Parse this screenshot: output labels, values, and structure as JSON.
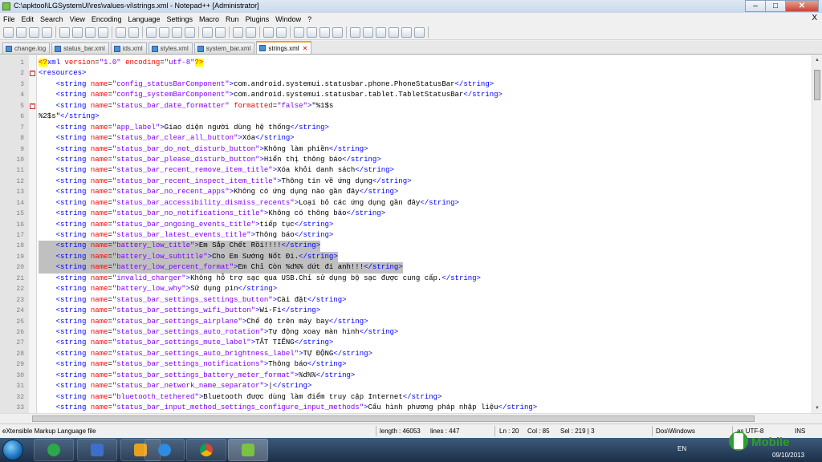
{
  "window": {
    "title": "C:\\apktool\\LGSystemUI\\res\\values-vi\\strings.xml - Notepad++ [Administrator]",
    "min_glyph": "–",
    "max_glyph": "□",
    "close_glyph": "✕"
  },
  "menu": [
    "File",
    "Edit",
    "Search",
    "View",
    "Encoding",
    "Language",
    "Settings",
    "Macro",
    "Run",
    "Plugins",
    "Window",
    "?"
  ],
  "menu_close": "X",
  "tabs": [
    {
      "label": "change.log"
    },
    {
      "label": "status_bar.xml"
    },
    {
      "label": "ids.xml"
    },
    {
      "label": "styles.xml"
    },
    {
      "label": "system_bar.xml"
    },
    {
      "label": "strings.xml",
      "active": true
    }
  ],
  "toolbar_icons": [
    "new-file",
    "open-file",
    "save",
    "save-all",
    "close",
    "close-all",
    "print",
    "cut",
    "copy",
    "paste",
    "undo",
    "redo",
    "find",
    "replace",
    "zoom-in",
    "zoom-out",
    "sync-v",
    "sync-h",
    "word-wrap",
    "all-chars",
    "indent-guide",
    "folder-view",
    "doc-map",
    "record-macro",
    "stop-record",
    "play-macro",
    "run-multiple",
    "save-macro",
    "spell-check",
    "compare"
  ],
  "lines": [
    {
      "n": "1",
      "fold": "",
      "segs": [
        [
          "pi",
          "<?"
        ],
        [
          "t",
          "xml "
        ],
        [
          "a",
          "version"
        ],
        [
          "x",
          "="
        ],
        [
          "v",
          "\"1.0\""
        ],
        [
          "x",
          " "
        ],
        [
          "a",
          "encoding"
        ],
        [
          "x",
          "="
        ],
        [
          "v",
          "\"utf-8\""
        ],
        [
          "pi",
          "?>"
        ]
      ]
    },
    {
      "n": "2",
      "fold": "-",
      "segs": [
        [
          "t",
          "<resources>"
        ]
      ]
    },
    {
      "n": "3",
      "fold": "",
      "segs": [
        [
          "x",
          "    "
        ],
        [
          "t",
          "<string "
        ],
        [
          "a",
          "name"
        ],
        [
          "x",
          "="
        ],
        [
          "v",
          "\"config_statusBarComponent\""
        ],
        [
          "t",
          ">"
        ],
        [
          "x",
          "com.android.systemui.statusbar.phone.PhoneStatusBar"
        ],
        [
          "t",
          "</string>"
        ]
      ]
    },
    {
      "n": "4",
      "fold": "",
      "segs": [
        [
          "x",
          "    "
        ],
        [
          "t",
          "<string "
        ],
        [
          "a",
          "name"
        ],
        [
          "x",
          "="
        ],
        [
          "v",
          "\"config_systemBarComponent\""
        ],
        [
          "t",
          ">"
        ],
        [
          "x",
          "com.android.systemui.statusbar.tablet.TabletStatusBar"
        ],
        [
          "t",
          "</string>"
        ]
      ]
    },
    {
      "n": "5",
      "fold": "-",
      "segs": [
        [
          "x",
          "    "
        ],
        [
          "t",
          "<string "
        ],
        [
          "a",
          "name"
        ],
        [
          "x",
          "="
        ],
        [
          "v",
          "\"status_bar_date_formatter\""
        ],
        [
          "x",
          " "
        ],
        [
          "a",
          "formatted"
        ],
        [
          "x",
          "="
        ],
        [
          "v",
          "\"false\""
        ],
        [
          "t",
          ">"
        ],
        [
          "x",
          "\"%1$s"
        ]
      ]
    },
    {
      "n": "6",
      "fold": "",
      "segs": [
        [
          "x",
          "%2$s\""
        ],
        [
          "t",
          "</string>"
        ]
      ]
    },
    {
      "n": "7",
      "fold": "",
      "segs": [
        [
          "x",
          "    "
        ],
        [
          "t",
          "<string "
        ],
        [
          "a",
          "name"
        ],
        [
          "x",
          "="
        ],
        [
          "v",
          "\"app_label\""
        ],
        [
          "t",
          ">"
        ],
        [
          "x",
          "Giao diện người dùng hệ thống"
        ],
        [
          "t",
          "</string>"
        ]
      ]
    },
    {
      "n": "8",
      "fold": "",
      "segs": [
        [
          "x",
          "    "
        ],
        [
          "t",
          "<string "
        ],
        [
          "a",
          "name"
        ],
        [
          "x",
          "="
        ],
        [
          "v",
          "\"status_bar_clear_all_button\""
        ],
        [
          "t",
          ">"
        ],
        [
          "x",
          "Xóa"
        ],
        [
          "t",
          "</string>"
        ]
      ]
    },
    {
      "n": "9",
      "fold": "",
      "segs": [
        [
          "x",
          "    "
        ],
        [
          "t",
          "<string "
        ],
        [
          "a",
          "name"
        ],
        [
          "x",
          "="
        ],
        [
          "v",
          "\"status_bar_do_not_disturb_button\""
        ],
        [
          "t",
          ">"
        ],
        [
          "x",
          "Không làm phiền"
        ],
        [
          "t",
          "</string>"
        ]
      ]
    },
    {
      "n": "10",
      "fold": "",
      "segs": [
        [
          "x",
          "    "
        ],
        [
          "t",
          "<string "
        ],
        [
          "a",
          "name"
        ],
        [
          "x",
          "="
        ],
        [
          "v",
          "\"status_bar_please_disturb_button\""
        ],
        [
          "t",
          ">"
        ],
        [
          "x",
          "Hiển thị thông báo"
        ],
        [
          "t",
          "</string>"
        ]
      ]
    },
    {
      "n": "11",
      "fold": "",
      "segs": [
        [
          "x",
          "    "
        ],
        [
          "t",
          "<string "
        ],
        [
          "a",
          "name"
        ],
        [
          "x",
          "="
        ],
        [
          "v",
          "\"status_bar_recent_remove_item_title\""
        ],
        [
          "t",
          ">"
        ],
        [
          "x",
          "Xóa khỏi danh sách"
        ],
        [
          "t",
          "</string>"
        ]
      ]
    },
    {
      "n": "12",
      "fold": "",
      "segs": [
        [
          "x",
          "    "
        ],
        [
          "t",
          "<string "
        ],
        [
          "a",
          "name"
        ],
        [
          "x",
          "="
        ],
        [
          "v",
          "\"status_bar_recent_inspect_item_title\""
        ],
        [
          "t",
          ">"
        ],
        [
          "x",
          "Thông tin về ứng dụng"
        ],
        [
          "t",
          "</string>"
        ]
      ]
    },
    {
      "n": "13",
      "fold": "",
      "segs": [
        [
          "x",
          "    "
        ],
        [
          "t",
          "<string "
        ],
        [
          "a",
          "name"
        ],
        [
          "x",
          "="
        ],
        [
          "v",
          "\"status_bar_no_recent_apps\""
        ],
        [
          "t",
          ">"
        ],
        [
          "x",
          "Không có ứng dụng nào gần đây"
        ],
        [
          "t",
          "</string>"
        ]
      ]
    },
    {
      "n": "14",
      "fold": "",
      "segs": [
        [
          "x",
          "    "
        ],
        [
          "t",
          "<string "
        ],
        [
          "a",
          "name"
        ],
        [
          "x",
          "="
        ],
        [
          "v",
          "\"status_bar_accessibility_dismiss_recents\""
        ],
        [
          "t",
          ">"
        ],
        [
          "x",
          "Loại bỏ các ứng dụng gần đây"
        ],
        [
          "t",
          "</string>"
        ]
      ]
    },
    {
      "n": "15",
      "fold": "",
      "segs": [
        [
          "x",
          "    "
        ],
        [
          "t",
          "<string "
        ],
        [
          "a",
          "name"
        ],
        [
          "x",
          "="
        ],
        [
          "v",
          "\"status_bar_no_notifications_title\""
        ],
        [
          "t",
          ">"
        ],
        [
          "x",
          "Không có thông báo"
        ],
        [
          "t",
          "</string>"
        ]
      ]
    },
    {
      "n": "16",
      "fold": "",
      "segs": [
        [
          "x",
          "    "
        ],
        [
          "t",
          "<string "
        ],
        [
          "a",
          "name"
        ],
        [
          "x",
          "="
        ],
        [
          "v",
          "\"status_bar_ongoing_events_title\""
        ],
        [
          "t",
          ">"
        ],
        [
          "x",
          "tiếp tục"
        ],
        [
          "t",
          "</string>"
        ]
      ]
    },
    {
      "n": "17",
      "fold": "",
      "segs": [
        [
          "x",
          "    "
        ],
        [
          "t",
          "<string "
        ],
        [
          "a",
          "name"
        ],
        [
          "x",
          "="
        ],
        [
          "v",
          "\"status_bar_latest_events_title\""
        ],
        [
          "t",
          ">"
        ],
        [
          "x",
          "Thông báo"
        ],
        [
          "t",
          "</string>"
        ]
      ]
    },
    {
      "n": "18",
      "fold": "",
      "hl": "sel",
      "segs": [
        [
          "x",
          "    "
        ],
        [
          "t",
          "<string "
        ],
        [
          "a",
          "name"
        ],
        [
          "x",
          "="
        ],
        [
          "v",
          "\"battery_low_title\""
        ],
        [
          "t",
          ">"
        ],
        [
          "x",
          "Em Sắp Chết Rồi!!!!"
        ],
        [
          "t",
          "</string>"
        ]
      ]
    },
    {
      "n": "19",
      "fold": "",
      "hl": "sel",
      "segs": [
        [
          "x",
          "    "
        ],
        [
          "t",
          "<string "
        ],
        [
          "a",
          "name"
        ],
        [
          "x",
          "="
        ],
        [
          "v",
          "\"battery_low_subtitle\""
        ],
        [
          "t",
          ">"
        ],
        [
          "x",
          "Cho Em Sướng Nốt Đi."
        ],
        [
          "t",
          "</string>"
        ]
      ]
    },
    {
      "n": "20",
      "fold": "",
      "hl": "sel",
      "segs": [
        [
          "x",
          "    "
        ],
        [
          "t",
          "<string "
        ],
        [
          "a",
          "name"
        ],
        [
          "x",
          "="
        ],
        [
          "v",
          "\"battery_low_percent_format\""
        ],
        [
          "t",
          ">"
        ],
        [
          "x",
          "Em Chỉ Còn %d%% dứt đi anh!!!"
        ],
        [
          "t",
          "</string>"
        ]
      ]
    },
    {
      "n": "21",
      "fold": "",
      "segs": [
        [
          "x",
          "    "
        ],
        [
          "t",
          "<string "
        ],
        [
          "a",
          "name"
        ],
        [
          "x",
          "="
        ],
        [
          "v",
          "\"invalid_charger\""
        ],
        [
          "t",
          ">"
        ],
        [
          "x",
          "Không hỗ trợ sạc qua USB.Chỉ sử dụng bộ sạc được cung cấp."
        ],
        [
          "t",
          "</string>"
        ]
      ]
    },
    {
      "n": "22",
      "fold": "",
      "segs": [
        [
          "x",
          "    "
        ],
        [
          "t",
          "<string "
        ],
        [
          "a",
          "name"
        ],
        [
          "x",
          "="
        ],
        [
          "v",
          "\"battery_low_why\""
        ],
        [
          "t",
          ">"
        ],
        [
          "x",
          "Sử dụng pin"
        ],
        [
          "t",
          "</string>"
        ]
      ]
    },
    {
      "n": "23",
      "fold": "",
      "segs": [
        [
          "x",
          "    "
        ],
        [
          "t",
          "<string "
        ],
        [
          "a",
          "name"
        ],
        [
          "x",
          "="
        ],
        [
          "v",
          "\"status_bar_settings_settings_button\""
        ],
        [
          "t",
          ">"
        ],
        [
          "x",
          "Cài đặt"
        ],
        [
          "t",
          "</string>"
        ]
      ]
    },
    {
      "n": "24",
      "fold": "",
      "segs": [
        [
          "x",
          "    "
        ],
        [
          "t",
          "<string "
        ],
        [
          "a",
          "name"
        ],
        [
          "x",
          "="
        ],
        [
          "v",
          "\"status_bar_settings_wifi_button\""
        ],
        [
          "t",
          ">"
        ],
        [
          "x",
          "Wi-Fi"
        ],
        [
          "t",
          "</string>"
        ]
      ]
    },
    {
      "n": "25",
      "fold": "",
      "segs": [
        [
          "x",
          "    "
        ],
        [
          "t",
          "<string "
        ],
        [
          "a",
          "name"
        ],
        [
          "x",
          "="
        ],
        [
          "v",
          "\"status_bar_settings_airplane\""
        ],
        [
          "t",
          ">"
        ],
        [
          "x",
          "Chế độ trên máy bay"
        ],
        [
          "t",
          "</string>"
        ]
      ]
    },
    {
      "n": "26",
      "fold": "",
      "segs": [
        [
          "x",
          "    "
        ],
        [
          "t",
          "<string "
        ],
        [
          "a",
          "name"
        ],
        [
          "x",
          "="
        ],
        [
          "v",
          "\"status_bar_settings_auto_rotation\""
        ],
        [
          "t",
          ">"
        ],
        [
          "x",
          "Tự động xoay màn hình"
        ],
        [
          "t",
          "</string>"
        ]
      ]
    },
    {
      "n": "27",
      "fold": "",
      "segs": [
        [
          "x",
          "    "
        ],
        [
          "t",
          "<string "
        ],
        [
          "a",
          "name"
        ],
        [
          "x",
          "="
        ],
        [
          "v",
          "\"status_bar_settings_mute_label\""
        ],
        [
          "t",
          ">"
        ],
        [
          "x",
          "TẮT TIẾNG"
        ],
        [
          "t",
          "</string>"
        ]
      ]
    },
    {
      "n": "28",
      "fold": "",
      "segs": [
        [
          "x",
          "    "
        ],
        [
          "t",
          "<string "
        ],
        [
          "a",
          "name"
        ],
        [
          "x",
          "="
        ],
        [
          "v",
          "\"status_bar_settings_auto_brightness_label\""
        ],
        [
          "t",
          ">"
        ],
        [
          "x",
          "TỰ ĐỘNG"
        ],
        [
          "t",
          "</string>"
        ]
      ]
    },
    {
      "n": "29",
      "fold": "",
      "segs": [
        [
          "x",
          "    "
        ],
        [
          "t",
          "<string "
        ],
        [
          "a",
          "name"
        ],
        [
          "x",
          "="
        ],
        [
          "v",
          "\"status_bar_settings_notifications\""
        ],
        [
          "t",
          ">"
        ],
        [
          "x",
          "Thông báo"
        ],
        [
          "t",
          "</string>"
        ]
      ]
    },
    {
      "n": "30",
      "fold": "",
      "segs": [
        [
          "x",
          "    "
        ],
        [
          "t",
          "<string "
        ],
        [
          "a",
          "name"
        ],
        [
          "x",
          "="
        ],
        [
          "v",
          "\"status_bar_settings_battery_meter_format\""
        ],
        [
          "t",
          ">"
        ],
        [
          "x",
          "%d%%"
        ],
        [
          "t",
          "</string>"
        ]
      ]
    },
    {
      "n": "31",
      "fold": "",
      "segs": [
        [
          "x",
          "    "
        ],
        [
          "t",
          "<string "
        ],
        [
          "a",
          "name"
        ],
        [
          "x",
          "="
        ],
        [
          "v",
          "\"status_bar_network_name_separator\""
        ],
        [
          "t",
          ">"
        ],
        [
          "x",
          "|"
        ],
        [
          "t",
          "</string>"
        ]
      ]
    },
    {
      "n": "32",
      "fold": "",
      "segs": [
        [
          "x",
          "    "
        ],
        [
          "t",
          "<string "
        ],
        [
          "a",
          "name"
        ],
        [
          "x",
          "="
        ],
        [
          "v",
          "\"bluetooth_tethered\""
        ],
        [
          "t",
          ">"
        ],
        [
          "x",
          "Bluetooth được dùng làm điểm truy cập Internet"
        ],
        [
          "t",
          "</string>"
        ]
      ]
    },
    {
      "n": "33",
      "fold": "",
      "segs": [
        [
          "x",
          "    "
        ],
        [
          "t",
          "<string "
        ],
        [
          "a",
          "name"
        ],
        [
          "x",
          "="
        ],
        [
          "v",
          "\"status_bar_input_method_settings_configure_input_methods\""
        ],
        [
          "t",
          ">"
        ],
        [
          "x",
          "Cấu hình phương pháp nhập liệu"
        ],
        [
          "t",
          "</string>"
        ]
      ]
    }
  ],
  "status": {
    "filetype": "eXtensible Markup Language file",
    "length": "length : 46053",
    "lines": "lines : 447",
    "ln": "Ln : 20",
    "col": "Col : 85",
    "sel": "Sel : 219 | 3",
    "eol": "Dos\\Windows",
    "encoding": "as UTF-8",
    "ins": "INS"
  },
  "taskbar": {
    "apps": [
      "browser-icon",
      "media-player-icon",
      "ie-icon",
      "chrome-icon",
      "notepadpp-icon"
    ],
    "lang": "EN",
    "date": "09/10/2013"
  },
  "watermark": {
    "text": "Mobile",
    "brand_color": "#2e9e2e"
  }
}
